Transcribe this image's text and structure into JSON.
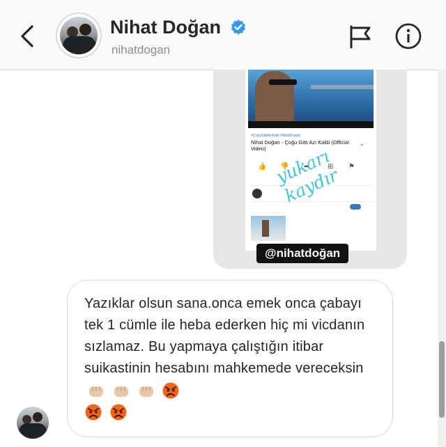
{
  "header": {
    "display_name": "Nihat Doğan",
    "username": "nihatdogan",
    "back_icon": "chevron-left-icon",
    "verified_icon": "verified-badge-icon",
    "flag_icon": "flag-icon",
    "info_icon": "info-icon",
    "verified_color": "#3897f0"
  },
  "story_share": {
    "video_tags": "#CoguGittiAzKaldi #NihatDogan",
    "video_title": "Nihat Doğan - Çoğu Gitti Azı Kaldı (Official Video)",
    "handwriting_line1": "yukarı",
    "handwriting_line2": "kaydır",
    "mention": "@nihatdoğan",
    "mention_bg": "#111111",
    "handwriting_color": "#43c3d6"
  },
  "message": {
    "text": "Yazıklar olsun sana.onca emek onca çabayı tek 1 cümle ile heba ederken hiç mi vicdanın sızlamaz. Bu yapmaya çalıştığın itibar suikastinin hesabını mahkemede vereceksin",
    "emojis": [
      "fist-emoji",
      "fist-emoji",
      "fist-emoji",
      "angry-face-emoji",
      "angry-face-emoji",
      "angry-face-emoji"
    ]
  }
}
